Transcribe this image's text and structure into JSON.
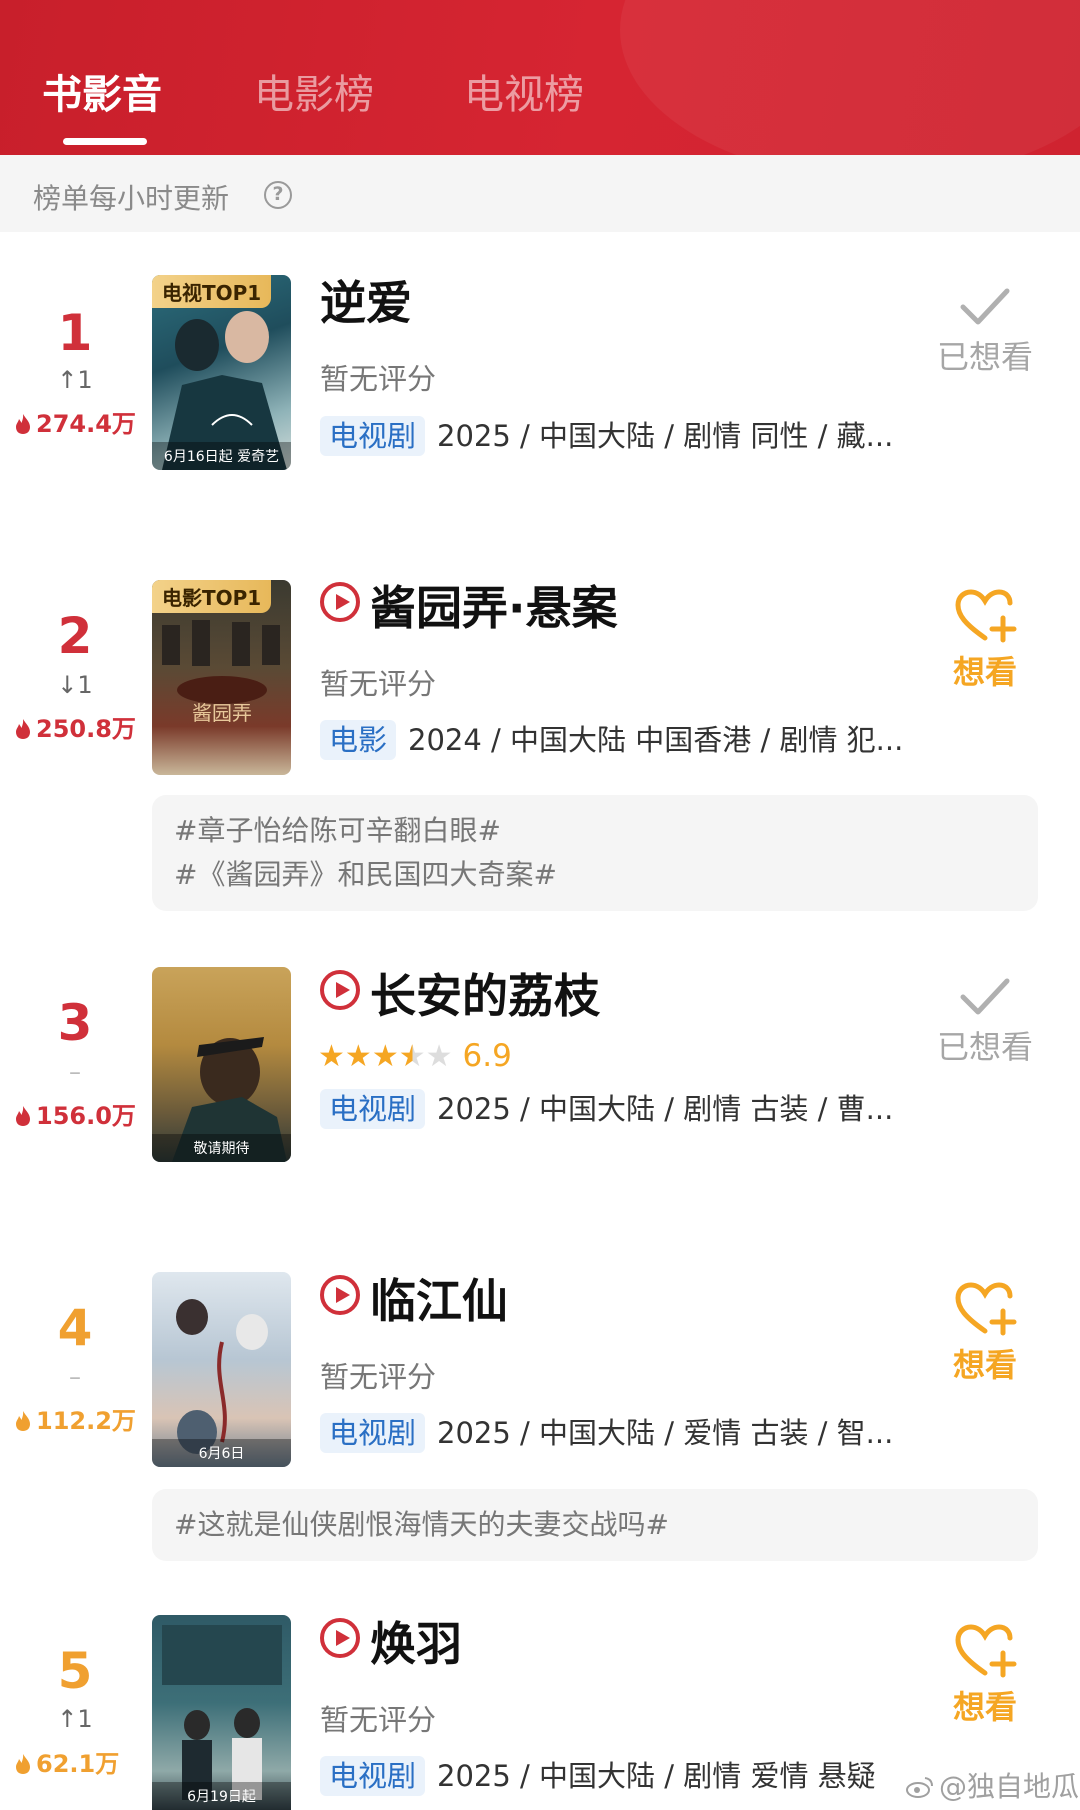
{
  "tabs": [
    {
      "label": "书影音",
      "active": true
    },
    {
      "label": "电影榜",
      "active": false
    },
    {
      "label": "电视榜",
      "active": false
    }
  ],
  "subbar": {
    "text": "榜单每小时更新",
    "help_icon": "question-circle-icon"
  },
  "items": [
    {
      "rank": "1",
      "change": "↑1",
      "heat": "274.4万",
      "title": "逆爱",
      "has_play": false,
      "rating": "暂无评分",
      "type": "电视剧",
      "meta": "2025 / 中国大陆 / 剧情 同性 / 藏...",
      "badge": "电视TOP1",
      "poster_caption": "6月16日起 爱奇艺",
      "action": "已想看",
      "action_state": "done",
      "topics": []
    },
    {
      "rank": "2",
      "change": "↓1",
      "heat": "250.8万",
      "title": "酱园弄·悬案",
      "has_play": true,
      "rating": "暂无评分",
      "type": "电影",
      "meta": "2024 / 中国大陆 中国香港 / 剧情 犯...",
      "badge": "电影TOP1",
      "poster_caption": "酱园弄 悬案",
      "action": "想看",
      "action_state": "want",
      "topics": [
        "#章子怡给陈可辛翻白眼#",
        "#《酱园弄》和民国四大奇案#"
      ]
    },
    {
      "rank": "3",
      "change": "–",
      "heat": "156.0万",
      "title": "长安的荔枝",
      "has_play": true,
      "stars": 3.5,
      "score": "6.9",
      "type": "电视剧",
      "meta": "2025 / 中国大陆 / 剧情 古装 / 曹...",
      "badge": "",
      "poster_caption": "敬请期待",
      "action": "已想看",
      "action_state": "done",
      "topics": []
    },
    {
      "rank": "4",
      "change": "–",
      "heat": "112.2万",
      "title": "临江仙",
      "has_play": true,
      "rating": "暂无评分",
      "type": "电视剧",
      "meta": "2025 / 中国大陆 / 爱情 古装 / 智...",
      "badge": "",
      "poster_caption": "6月6日",
      "action": "想看",
      "action_state": "want",
      "topics": [
        "#这就是仙侠剧恨海情天的夫妻交战吗#"
      ]
    },
    {
      "rank": "5",
      "change": "↑1",
      "heat": "62.1万",
      "title": "焕羽",
      "has_play": true,
      "rating": "暂无评分",
      "type": "电视剧",
      "meta": "2025 / 中国大陆 / 剧情 爱情 悬疑",
      "badge": "",
      "poster_caption": "6月19日起",
      "action": "想看",
      "action_state": "want",
      "topics": []
    }
  ],
  "watermark": "@独自地瓜",
  "colors": {
    "header_red": "#d62532",
    "rank_red": "#d0303a",
    "rank_orange": "#f0a030",
    "star": "#f5a623",
    "tag_blue": "#2a6fc4"
  }
}
